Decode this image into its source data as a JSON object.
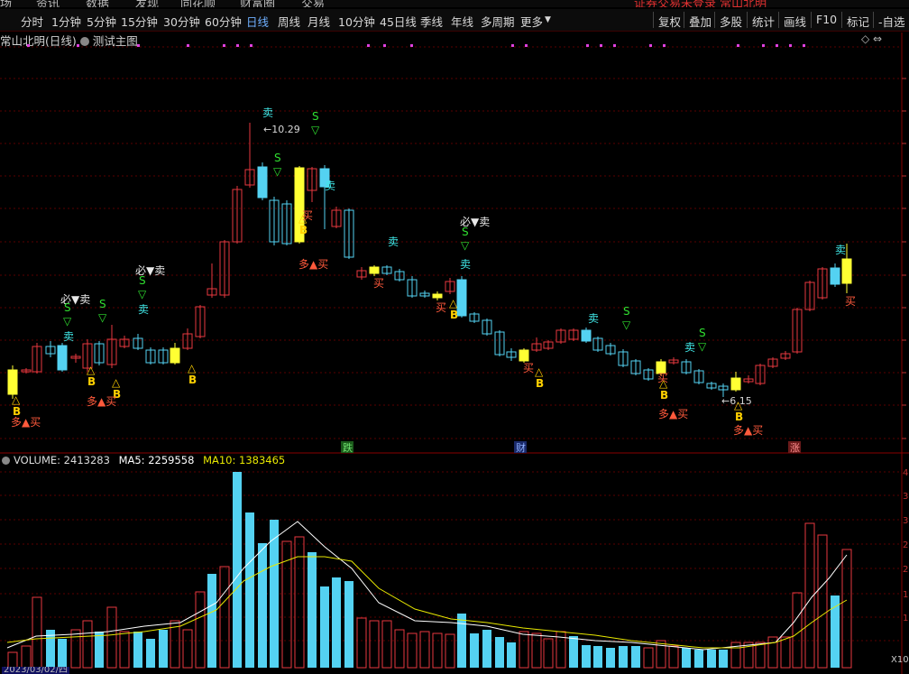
{
  "top_menu": [
    "场",
    "资讯",
    "数据",
    "发现",
    "同花顺",
    "财富圈",
    "交易"
  ],
  "top_warning": "证券交易未登录  常山北明",
  "toolbar": {
    "periods": [
      "分时",
      "1分钟",
      "5分钟",
      "15分钟",
      "30分钟",
      "60分钟",
      "日线",
      "周线",
      "月线",
      "10分钟",
      "45日线",
      "季线",
      "年线",
      "多周期",
      "更多"
    ],
    "active_period": "日线",
    "more_caret": "▼",
    "right_buttons": [
      "复权",
      "叠加",
      "多股",
      "统计",
      "画线",
      "F10",
      "标记",
      "-自选"
    ]
  },
  "chart_title": {
    "stock": "常山北明(日线)",
    "indicator": "测试主图",
    "right_icons": "◇ ⇔"
  },
  "labels": {
    "sell": "卖",
    "buy": "买",
    "duo_buy": "多▲买",
    "bi_sell": "必▼卖",
    "s": "S",
    "b": "B",
    "tri_down": "▽",
    "tri_up": "△"
  },
  "price_annotations": {
    "high": "10.29",
    "low": "6.15"
  },
  "event_tags": [
    "跌",
    "财",
    "涨"
  ],
  "volume_header": {
    "volume_label": "VOLUME: 2413283",
    "ma5_label": "MA5: 2259558",
    "ma10_label": "MA10: 1383465"
  },
  "bottom_date": "2023/03/02/四",
  "vol_unit": "X10",
  "colors": {
    "up": "#e8393f",
    "down": "#54d2f2",
    "special": "#ffff33",
    "sell_text": "#40e8e8",
    "buy_text": "#ff5a3c",
    "s_text": "#30e030",
    "ma5": "#ffffff",
    "ma10": "#e8e800",
    "grid": "#5a0000"
  },
  "chart_data": {
    "type": "candlestick",
    "price_high_label": 10.29,
    "price_low_label": 6.15,
    "annotations_markers": "卖 / 买 / S / B signals from 测试主图 indicator"
  }
}
